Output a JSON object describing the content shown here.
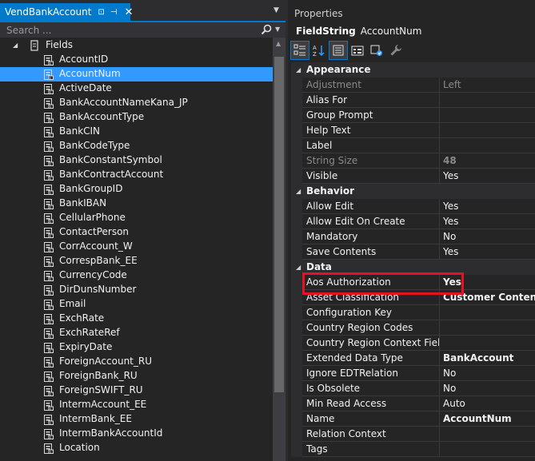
{
  "left_panel": {
    "tab_title": "VendBankAccount",
    "tab_pin_glyph": "⊡",
    "tab_autohide_glyph": "⊣",
    "tab_close_glyph": "✕",
    "search_placeholder": "Search ...",
    "tree_root_label": "Fields",
    "fields": [
      {
        "label": "AccountID",
        "selected": false
      },
      {
        "label": "AccountNum",
        "selected": true
      },
      {
        "label": "ActiveDate",
        "selected": false
      },
      {
        "label": "BankAccountNameKana_JP",
        "selected": false
      },
      {
        "label": "BankAccountType",
        "selected": false
      },
      {
        "label": "BankCIN",
        "selected": false
      },
      {
        "label": "BankCodeType",
        "selected": false
      },
      {
        "label": "BankConstantSymbol",
        "selected": false
      },
      {
        "label": "BankContractAccount",
        "selected": false
      },
      {
        "label": "BankGroupID",
        "selected": false
      },
      {
        "label": "BankIBAN",
        "selected": false
      },
      {
        "label": "CellularPhone",
        "selected": false
      },
      {
        "label": "ContactPerson",
        "selected": false
      },
      {
        "label": "CorrAccount_W",
        "selected": false
      },
      {
        "label": "CorrespBank_EE",
        "selected": false
      },
      {
        "label": "CurrencyCode",
        "selected": false
      },
      {
        "label": "DirDunsNumber",
        "selected": false
      },
      {
        "label": "Email",
        "selected": false
      },
      {
        "label": "ExchRate",
        "selected": false
      },
      {
        "label": "ExchRateRef",
        "selected": false
      },
      {
        "label": "ExpiryDate",
        "selected": false
      },
      {
        "label": "ForeignAccount_RU",
        "selected": false
      },
      {
        "label": "ForeignBank_RU",
        "selected": false
      },
      {
        "label": "ForeignSWIFT_RU",
        "selected": false
      },
      {
        "label": "IntermAccount_EE",
        "selected": false
      },
      {
        "label": "IntermBank_EE",
        "selected": false
      },
      {
        "label": "IntermBankAccountId",
        "selected": false
      },
      {
        "label": "Location",
        "selected": false
      }
    ]
  },
  "properties": {
    "title": "Properties",
    "object_type": "FieldString",
    "object_name": "AccountNum",
    "categories": [
      {
        "name": "Appearance",
        "rows": [
          {
            "name": "Adjustment",
            "value": "Left",
            "readonly": true,
            "bold": false
          },
          {
            "name": "Alias For",
            "value": "",
            "readonly": false,
            "bold": false
          },
          {
            "name": "Group Prompt",
            "value": "",
            "readonly": false,
            "bold": false
          },
          {
            "name": "Help Text",
            "value": "",
            "readonly": false,
            "bold": false
          },
          {
            "name": "Label",
            "value": "",
            "readonly": false,
            "bold": false
          },
          {
            "name": "String Size",
            "value": "48",
            "readonly": true,
            "bold": true
          },
          {
            "name": "Visible",
            "value": "Yes",
            "readonly": false,
            "bold": false
          }
        ]
      },
      {
        "name": "Behavior",
        "rows": [
          {
            "name": "Allow Edit",
            "value": "Yes",
            "readonly": false,
            "bold": false
          },
          {
            "name": "Allow Edit On Create",
            "value": "Yes",
            "readonly": false,
            "bold": false
          },
          {
            "name": "Mandatory",
            "value": "No",
            "readonly": false,
            "bold": false
          },
          {
            "name": "Save Contents",
            "value": "Yes",
            "readonly": false,
            "bold": false
          }
        ]
      },
      {
        "name": "Data",
        "rows": [
          {
            "name": "Aos Authorization",
            "value": "Yes",
            "readonly": false,
            "bold": true
          },
          {
            "name": "Asset Classification",
            "value": "Customer Content",
            "readonly": false,
            "bold": true
          },
          {
            "name": "Configuration Key",
            "value": "",
            "readonly": false,
            "bold": false
          },
          {
            "name": "Country Region Codes",
            "value": "",
            "readonly": false,
            "bold": false
          },
          {
            "name": "Country Region Context Field",
            "value": "",
            "readonly": false,
            "bold": false
          },
          {
            "name": "Extended Data Type",
            "value": "BankAccount",
            "readonly": false,
            "bold": true
          },
          {
            "name": "Ignore EDTRelation",
            "value": "No",
            "readonly": false,
            "bold": false
          },
          {
            "name": "Is Obsolete",
            "value": "No",
            "readonly": false,
            "bold": false
          },
          {
            "name": "Min Read Access",
            "value": "Auto",
            "readonly": false,
            "bold": false
          },
          {
            "name": "Name",
            "value": "AccountNum",
            "readonly": false,
            "bold": true
          },
          {
            "name": "Relation Context",
            "value": "",
            "readonly": false,
            "bold": false
          },
          {
            "name": "Tags",
            "value": "",
            "readonly": false,
            "bold": false
          }
        ]
      }
    ]
  },
  "colors": {
    "accent": "#007acc",
    "selection": "#3399ff",
    "highlight_box": "#e81123"
  },
  "icons": [
    "pin-icon",
    "autohide-icon",
    "close-icon",
    "search-icon",
    "field-icon",
    "folder-icon",
    "categorized-icon",
    "alphabetical-icon",
    "properties-icon",
    "events-icon",
    "property-pages-icon",
    "wrench-icon"
  ]
}
